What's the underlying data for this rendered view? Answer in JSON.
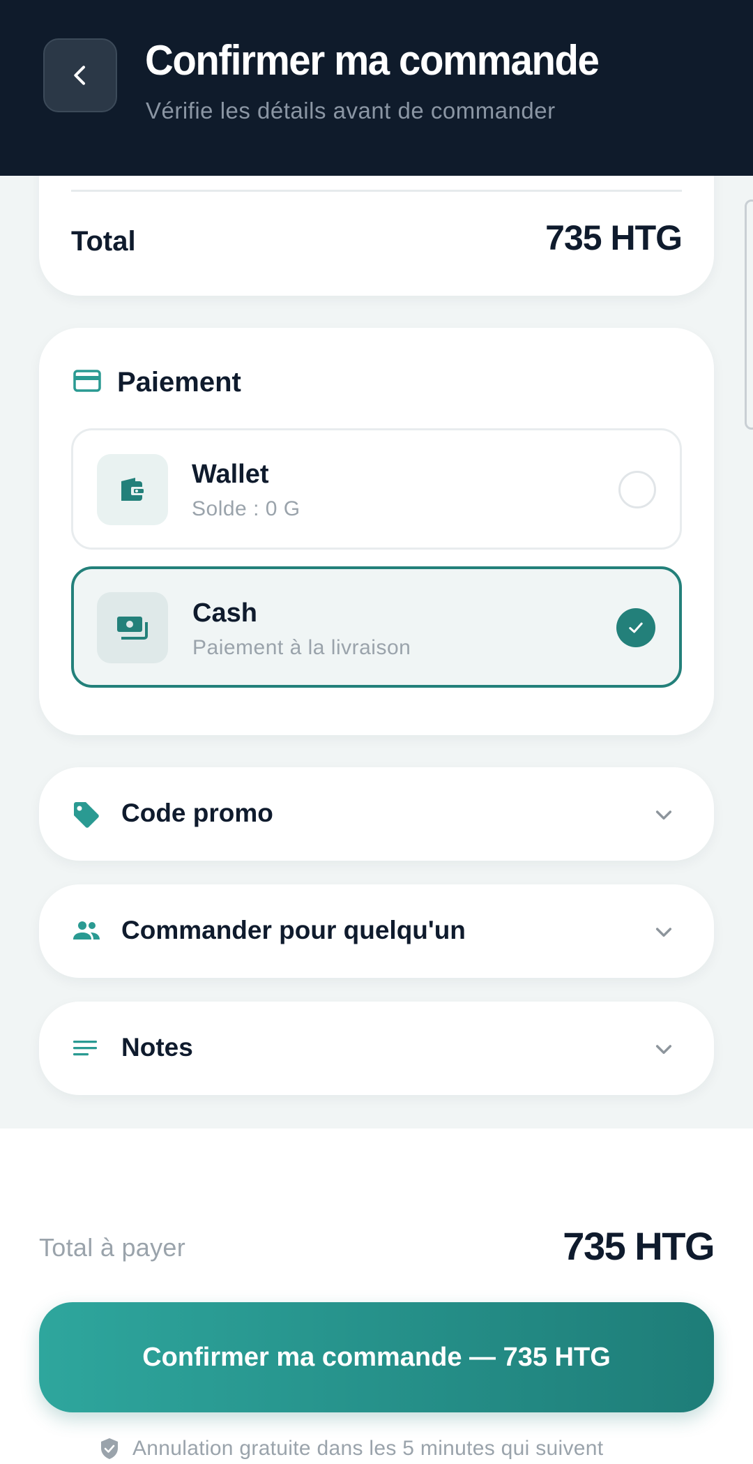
{
  "header": {
    "title": "Confirmer ma commande",
    "subtitle": "Vérifie les détails avant de commander"
  },
  "summary": {
    "total_label": "Total",
    "total_value": "735 HTG"
  },
  "payment": {
    "title": "Paiement",
    "options": [
      {
        "name": "Wallet",
        "subtitle": "Solde : 0 G",
        "selected": false,
        "icon": "wallet-icon"
      },
      {
        "name": "Cash",
        "subtitle": "Paiement à la livraison",
        "selected": true,
        "icon": "cash-icon"
      }
    ]
  },
  "sections": [
    {
      "label": "Code promo",
      "icon": "tag-icon"
    },
    {
      "label": "Commander pour quelqu'un",
      "icon": "people-icon"
    },
    {
      "label": "Notes",
      "icon": "notes-icon"
    }
  ],
  "footer": {
    "pay_label": "Total à payer",
    "pay_value": "735 HTG",
    "confirm_label": "Confirmer ma commande — 735 HTG",
    "note": "Annulation gratuite dans les 5 minutes qui suivent"
  },
  "colors": {
    "header_bg": "#0f1b2b",
    "accent": "#23807a",
    "accent_light": "#2ea69d",
    "text_dark": "#0f1b2d",
    "text_muted": "#9aa3ab"
  }
}
